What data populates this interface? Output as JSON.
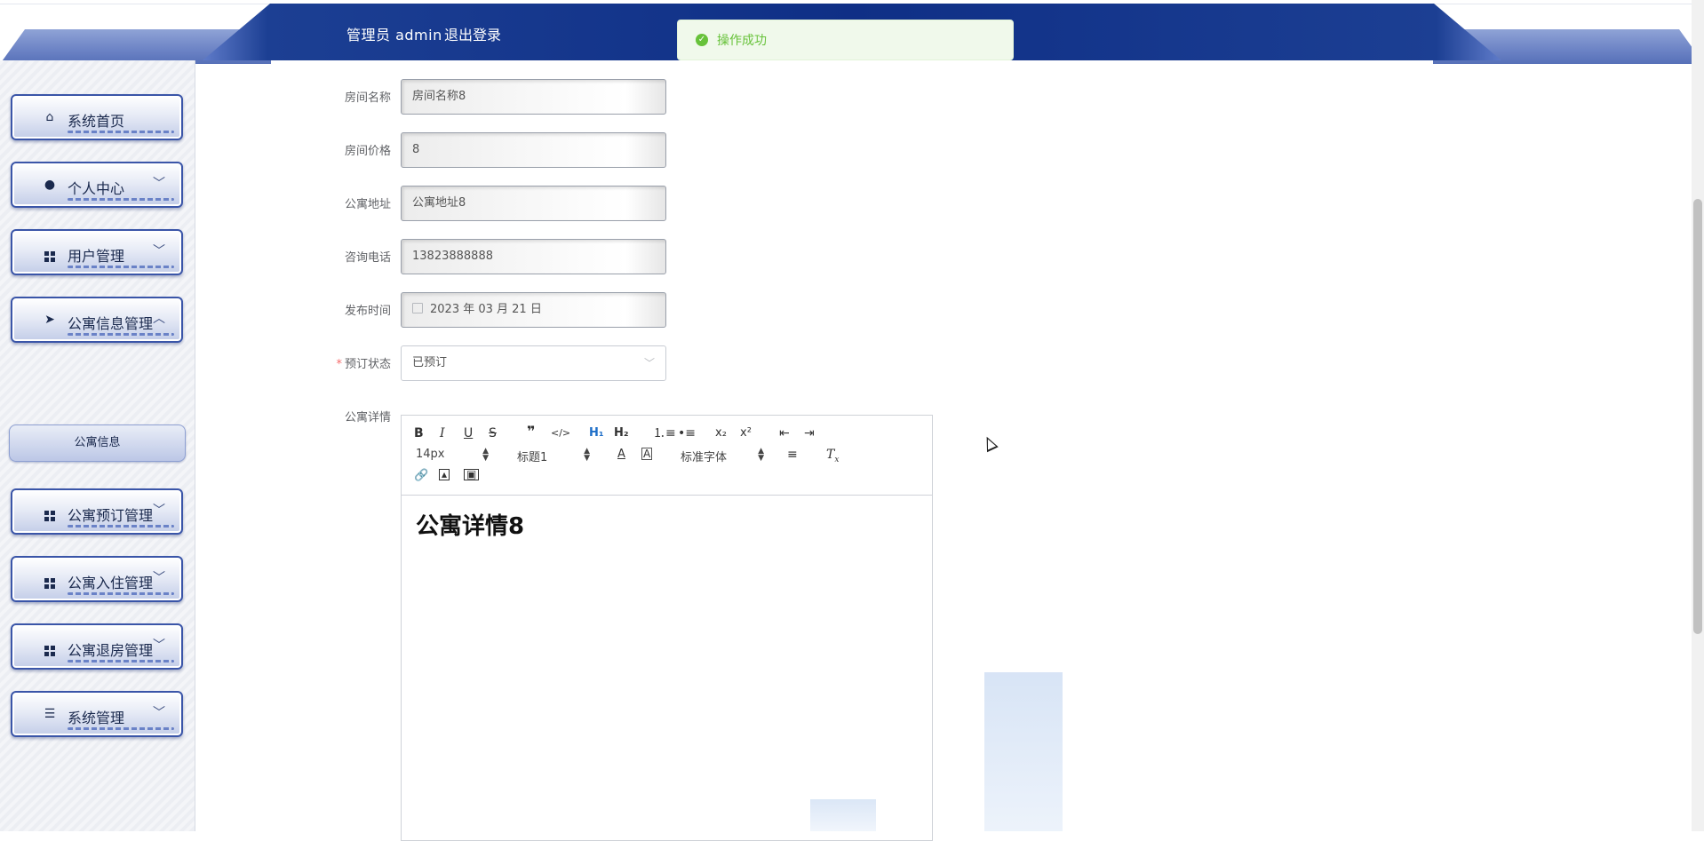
{
  "header": {
    "user_text": "管理员 admin",
    "logout_label": "退出登录"
  },
  "toast": {
    "message": "操作成功",
    "status_color": "#67c23a"
  },
  "sidebar": {
    "items": [
      {
        "label": "系统首页",
        "icon": "home-icon"
      },
      {
        "label": "个人中心",
        "icon": "user-icon"
      },
      {
        "label": "用户管理",
        "icon": "grid-icon"
      },
      {
        "label": "公寓信息管理",
        "icon": "send-icon"
      },
      {
        "label": "公寓预订管理",
        "icon": "grid-icon"
      },
      {
        "label": "公寓入住管理",
        "icon": "grid-icon"
      },
      {
        "label": "公寓退房管理",
        "icon": "grid-icon"
      },
      {
        "label": "系统管理",
        "icon": "sliders-icon"
      }
    ],
    "submenu": {
      "label": "公寓信息"
    }
  },
  "form": {
    "room_name": {
      "label": "房间名称",
      "value": "房间名称8"
    },
    "room_price": {
      "label": "房间价格",
      "value": "8"
    },
    "address": {
      "label": "公寓地址",
      "value": "公寓地址8"
    },
    "phone": {
      "label": "咨询电话",
      "value": "13823888888"
    },
    "publish_time": {
      "label": "发布时间",
      "value": "2023 年 03 月 21 日"
    },
    "booking_status": {
      "label": "预订状态",
      "required_mark": "*",
      "value": "已预订"
    },
    "details": {
      "label": "公寓详情"
    }
  },
  "editor": {
    "font_size": "14px",
    "heading": "标题1",
    "font_family": "标准字体",
    "content_heading": "公寓详情8"
  }
}
